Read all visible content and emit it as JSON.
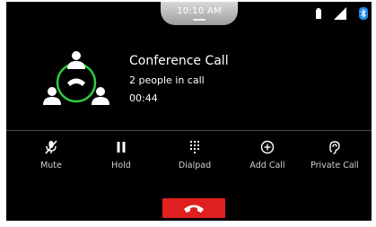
{
  "status": {
    "time": "10:10 AM"
  },
  "call": {
    "title": "Conference Call",
    "participants": "2 people in call",
    "timer": "00:44"
  },
  "actions": [
    {
      "label": "Mute",
      "icon": "mute-icon"
    },
    {
      "label": "Hold",
      "icon": "pause-icon"
    },
    {
      "label": "Dialpad",
      "icon": "dialpad-icon"
    },
    {
      "label": "Add Call",
      "icon": "add-call-icon"
    },
    {
      "label": "Private Call",
      "icon": "private-call-icon"
    }
  ],
  "end_call": {
    "icon": "end-call-icon",
    "color": "#e02020"
  },
  "colors": {
    "accent": "#2ecc40",
    "background": "#000000"
  }
}
